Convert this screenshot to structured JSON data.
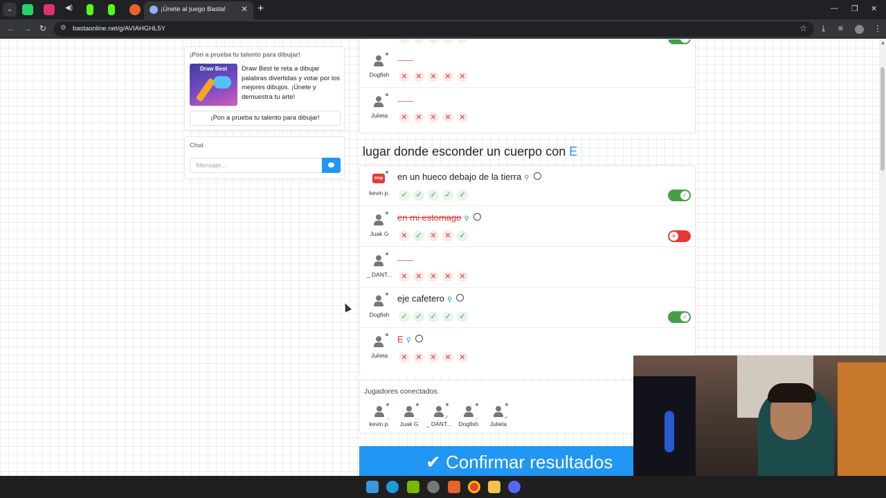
{
  "browser": {
    "active_tab_title": "¡Únete al juego Basta!",
    "url": "bastaonline.net/g/AVIAHGHL5Y",
    "new_tab_label": "+",
    "tab_close": "✕"
  },
  "promo": {
    "heading": "¡Pon a prueba tu talento para dibujar!",
    "image_title": "Draw Best",
    "description": "Draw Best te reta a dibujar palabras divertidas y votar por los mejores dibujos. ¡Únete y demuestra tu arte!",
    "button_label": "¡Pon a prueba tu talento para dibujar!"
  },
  "chat": {
    "heading": "Chat",
    "placeholder": "Mensaje..."
  },
  "prev_category": {
    "rows": [
      {
        "player": "Dogfish"
      },
      {
        "player": "Julieta"
      }
    ]
  },
  "category": {
    "title": "lugar donde esconder un cuerpo con",
    "letter": "E",
    "rows": [
      {
        "player": "kevin p.",
        "answer": "en un hueco debajo de la tierra"
      },
      {
        "player": "Juak G",
        "answer": "en mi estomago"
      },
      {
        "player": "_ DANT..."
      },
      {
        "player": "Dogfish",
        "answer": "eje cafetero"
      },
      {
        "player": "Julieta",
        "answer": "E"
      }
    ]
  },
  "connected": {
    "heading": "Jugadores conectados.",
    "players": [
      {
        "name": "kevin p.",
        "status": "..."
      },
      {
        "name": "Juak G",
        "status": "..."
      },
      {
        "name": "_ DANT...",
        "status": "✓"
      },
      {
        "name": "Dogfish",
        "status": "..."
      },
      {
        "name": "Julieta",
        "status": "✓"
      }
    ]
  },
  "confirm_label": "✔ Confirmar resultados",
  "icons": {
    "check": "✓",
    "cross": "✕",
    "search": "🔍",
    "stop": "stop"
  },
  "colors": {
    "accent": "#2196f3",
    "ok": "#43a047",
    "bad": "#e53935"
  }
}
